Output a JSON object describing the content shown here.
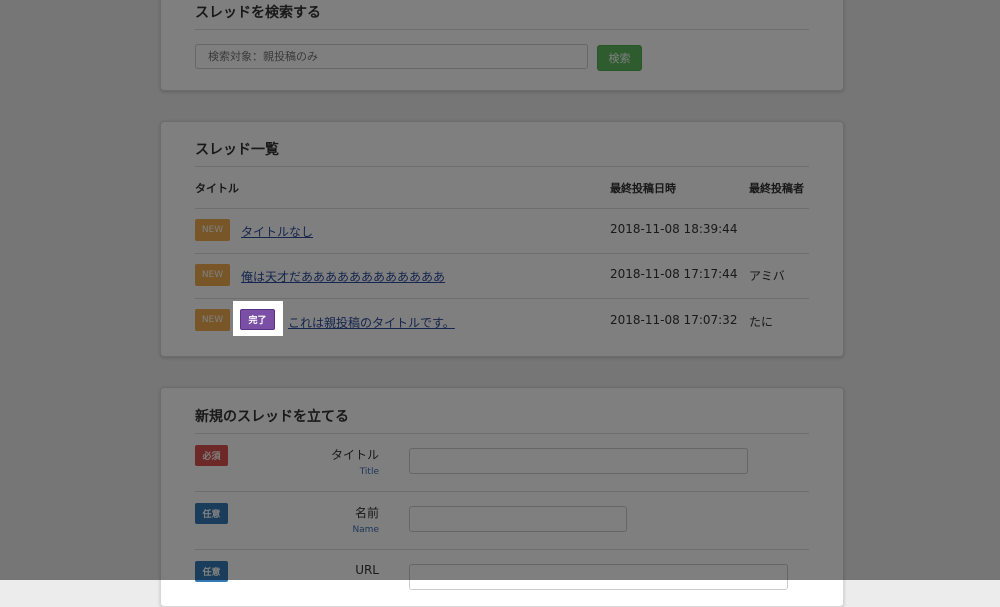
{
  "search": {
    "title": "スレッドを検索する",
    "placeholder": "検索対象：親投稿のみ",
    "button_label": "検索"
  },
  "thread_list": {
    "title": "スレッド一覧",
    "columns": [
      "タイトル",
      "最終投稿日時",
      "最終投稿者"
    ],
    "rows": [
      {
        "badge": "NEW",
        "status": "",
        "title": "タイトルなし",
        "datetime": "2018-11-08 18:39:44",
        "poster": ""
      },
      {
        "badge": "NEW",
        "status": "",
        "title": "俺は天才だああああああああああああ",
        "datetime": "2018-11-08 17:17:44",
        "poster": "アミバ"
      },
      {
        "badge": "NEW",
        "status": "完了",
        "title": "これは親投稿のタイトルです。",
        "datetime": "2018-11-08 17:07:32",
        "poster": "たに"
      }
    ]
  },
  "new_thread": {
    "title": "新規のスレッドを立てる",
    "fields": [
      {
        "tag": "必須",
        "label": "タイトル",
        "sublabel": "Title"
      },
      {
        "tag": "任意",
        "label": "名前",
        "sublabel": "Name"
      },
      {
        "tag": "任意",
        "label": "URL",
        "sublabel": ""
      }
    ]
  },
  "colors": {
    "new_badge": "#f0ad4e",
    "done_badge": "#7b4fa5",
    "required_tag": "#d9534f",
    "optional_tag": "#337ab7",
    "search_button": "#5cb85c"
  }
}
